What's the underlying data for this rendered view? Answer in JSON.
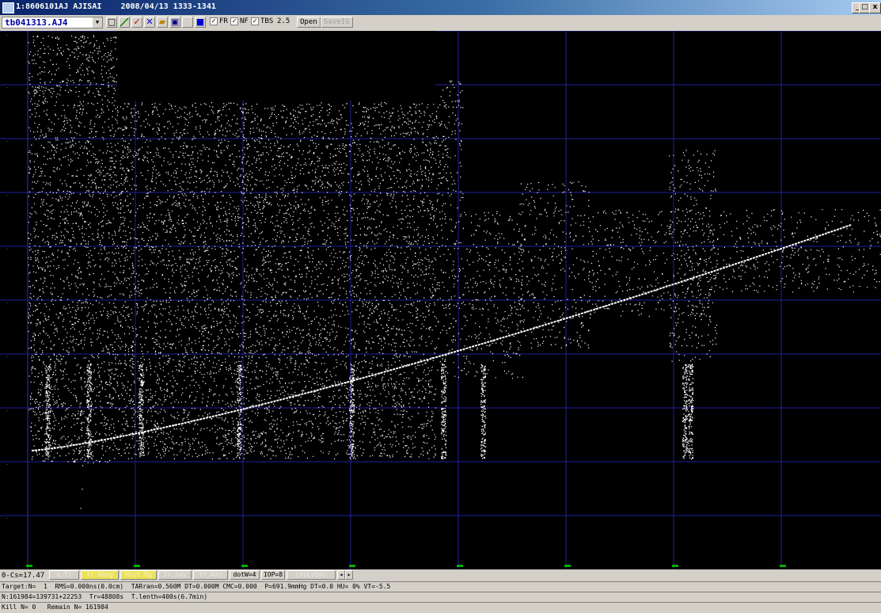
{
  "window": {
    "title": "1:8606101AJ AJISAI    2008/04/13 1333-1341",
    "controls": {
      "minimize": "_",
      "maximize": "□",
      "close": "x"
    }
  },
  "toolbar": {
    "file_name": "tb041313.AJ4",
    "checkbox_fr": {
      "label": "FR",
      "checked": true
    },
    "checkbox_nf": {
      "label": "NF",
      "checked": true
    },
    "checkbox_tbs": {
      "label": "TBS",
      "checked": true
    },
    "tbs_value": "2.5",
    "open_label": "Open",
    "save_label": "SaveIG",
    "icons": [
      "square-icon",
      "line-icon",
      "check-icon",
      "x-icon",
      "folder-icon",
      "save-icon",
      "blank-icon",
      "stop-icon"
    ]
  },
  "plot": {
    "bg": "#000000",
    "grid_color": "#2020a0",
    "axis_label_color": "#00b000",
    "dot_color": "#ffffff"
  },
  "status": {
    "cs": "0-Cs=17.47",
    "buttons": [
      {
        "label": "k.Tr",
        "style": "gray"
      },
      {
        "label": "Tr.Rang",
        "style": "yellow"
      },
      {
        "label": "Hist.Rg",
        "style": "yellow"
      },
      {
        "label": "Tr.Sav",
        "style": "gray"
      },
      {
        "label": "Tr.Adj",
        "style": "gray"
      },
      {
        "label": "dotW=4",
        "style": "dark"
      },
      {
        "label": "IOP=8",
        "style": "dark"
      },
      {
        "label": "ChuLeSav",
        "style": "gray"
      }
    ],
    "line1": "Target:N=  1  RMS=0.000ns(0.0cm)  TARran=0.560M DT=0.000M CMC=0.000  P=691.9mmHg DT=0.0 HU= 0% VT=-5.5",
    "line2": "N:161984=139731+22253  Tr=48808s  T.lenth=400s(6.7min)",
    "line3": "Kill N= 0   Remain N= 161984"
  }
}
